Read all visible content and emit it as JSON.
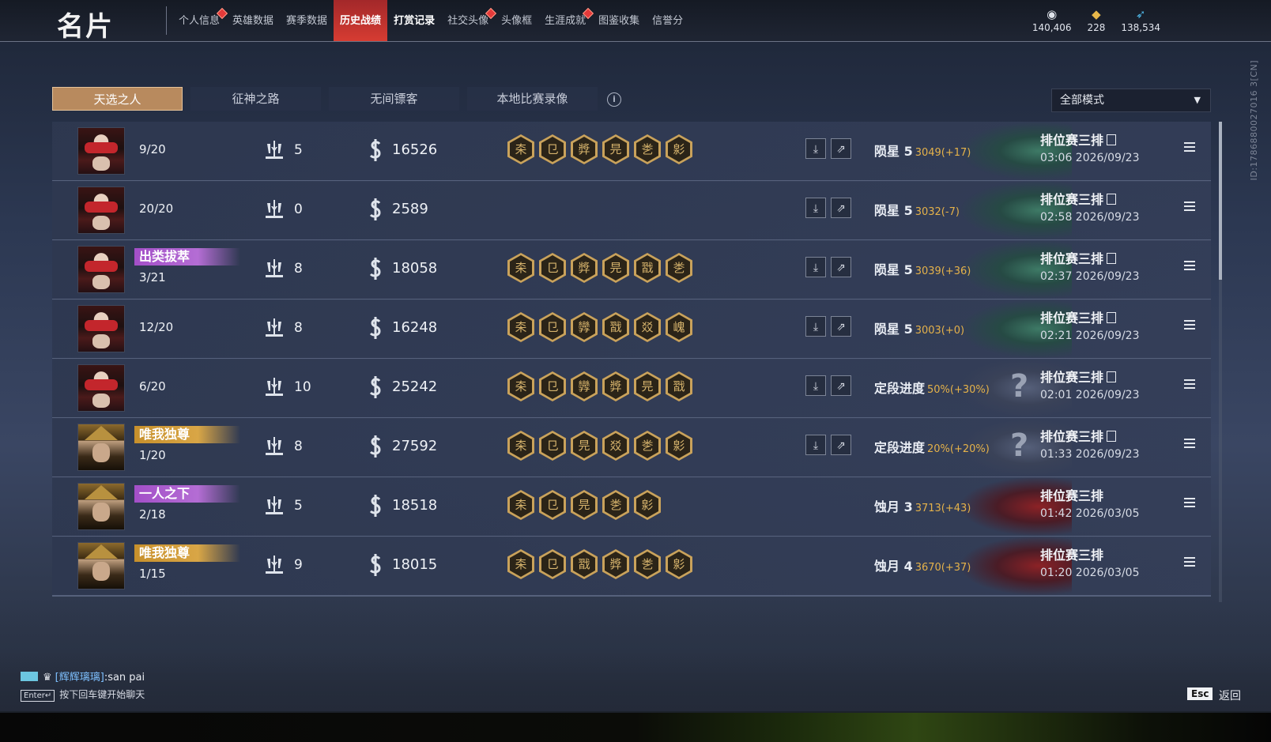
{
  "header": {
    "title": "名片",
    "nav": [
      {
        "label": "个人信息",
        "badge": true,
        "state": "normal"
      },
      {
        "label": "英雄数据",
        "badge": false,
        "state": "normal"
      },
      {
        "label": "赛季数据",
        "badge": false,
        "state": "normal"
      },
      {
        "label": "历史战绩",
        "badge": false,
        "state": "active"
      },
      {
        "label": "打赏记录",
        "badge": false,
        "state": "bold"
      },
      {
        "label": "社交头像",
        "badge": true,
        "state": "normal"
      },
      {
        "label": "头像框",
        "badge": false,
        "state": "normal"
      },
      {
        "label": "生涯成就",
        "badge": true,
        "state": "normal"
      },
      {
        "label": "图鉴收集",
        "badge": false,
        "state": "normal"
      },
      {
        "label": "信誉分",
        "badge": false,
        "state": "normal"
      }
    ],
    "currencies": [
      {
        "icon": "coin-eye-icon",
        "value": "140,406"
      },
      {
        "icon": "gold-ingot-icon",
        "value": "228"
      },
      {
        "icon": "feather-icon",
        "value": "138,534"
      }
    ]
  },
  "tabs": [
    {
      "label": "天选之人",
      "active": true
    },
    {
      "label": "征神之路",
      "active": false
    },
    {
      "label": "无间镖客",
      "active": false
    },
    {
      "label": "本地比赛录像",
      "active": false
    }
  ],
  "mode_select": {
    "value": "全部模式"
  },
  "side_id": "ID:1786880027016 3[CN]",
  "matches": [
    {
      "avatar": "red-mask",
      "title": "",
      "title_color": "",
      "score": "9/20",
      "kills": "5",
      "money": "16526",
      "medals": [
        "㚓",
        "㔾",
        "㢡",
        "㫕",
        "㐘",
        "㣐"
      ],
      "actions": true,
      "rank": "陨星 5",
      "rank_delta": "3049(+17)",
      "emblem": "green",
      "match_type": "排位赛三排",
      "replay": true,
      "time": "03:06 2026/09/23"
    },
    {
      "avatar": "red-mask",
      "title": "",
      "title_color": "",
      "score": "20/20",
      "kills": "0",
      "money": "2589",
      "medals": [],
      "actions": true,
      "rank": "陨星 5",
      "rank_delta": "3032(-7)",
      "emblem": "green",
      "match_type": "排位赛三排",
      "replay": true,
      "time": "02:58 2026/09/23"
    },
    {
      "avatar": "red-mask",
      "title": "出类拔萃",
      "title_color": "purple",
      "score": "3/21",
      "kills": "8",
      "money": "18058",
      "medals": [
        "㚓",
        "㔾",
        "㢡",
        "㫕",
        "㦻",
        "㐘"
      ],
      "actions": true,
      "rank": "陨星 5",
      "rank_delta": "3039(+36)",
      "emblem": "green",
      "match_type": "排位赛三排",
      "replay": true,
      "time": "02:37 2026/09/23"
    },
    {
      "avatar": "red-mask",
      "title": "",
      "title_color": "",
      "score": "12/20",
      "kills": "8",
      "money": "16248",
      "medals": [
        "㚓",
        "㔾",
        "㝈",
        "㦻",
        "㸚",
        "㟴"
      ],
      "actions": true,
      "rank": "陨星 5",
      "rank_delta": "3003(+0)",
      "emblem": "green",
      "match_type": "排位赛三排",
      "replay": true,
      "time": "02:21 2026/09/23"
    },
    {
      "avatar": "red-mask",
      "title": "",
      "title_color": "",
      "score": "6/20",
      "kills": "10",
      "money": "25242",
      "medals": [
        "㚓",
        "㔾",
        "㝈",
        "㢡",
        "㫕",
        "㦻"
      ],
      "actions": true,
      "rank": "定段进度",
      "rank_delta": "50%(+30%)",
      "emblem": "grey",
      "match_type": "排位赛三排",
      "replay": true,
      "time": "02:01 2026/09/23"
    },
    {
      "avatar": "gold-helm",
      "title": "唯我独尊",
      "title_color": "gold",
      "score": "1/20",
      "kills": "8",
      "money": "27592",
      "medals": [
        "㚓",
        "㔾",
        "㫕",
        "㸚",
        "㐘",
        "㣐"
      ],
      "actions": true,
      "rank": "定段进度",
      "rank_delta": "20%(+20%)",
      "emblem": "grey",
      "match_type": "排位赛三排",
      "replay": true,
      "time": "01:33 2026/09/23"
    },
    {
      "avatar": "gold-helm",
      "title": "一人之下",
      "title_color": "purple",
      "score": "2/18",
      "kills": "5",
      "money": "18518",
      "medals": [
        "㚓",
        "㔾",
        "㫕",
        "㐘",
        "㣐"
      ],
      "actions": false,
      "rank": "蚀月 3",
      "rank_delta": "3713(+43)",
      "emblem": "red",
      "match_type": "排位赛三排",
      "replay": false,
      "time": "01:42 2026/03/05"
    },
    {
      "avatar": "gold-helm",
      "title": "唯我独尊",
      "title_color": "gold",
      "score": "1/15",
      "kills": "9",
      "money": "18015",
      "medals": [
        "㚓",
        "㔾",
        "㦻",
        "㢡",
        "㐘",
        "㣐"
      ],
      "actions": false,
      "rank": "蚀月 4",
      "rank_delta": "3670(+37)",
      "emblem": "red",
      "match_type": "排位赛三排",
      "replay": false,
      "time": "01:20 2026/03/05"
    }
  ],
  "chat": {
    "name": "[辉辉璃璃]",
    "message": ":san pai",
    "hint_key": "Enter↵",
    "hint": "按下回车键开始聊天"
  },
  "footer": {
    "esc_key": "Esc",
    "back_label": "返回"
  }
}
